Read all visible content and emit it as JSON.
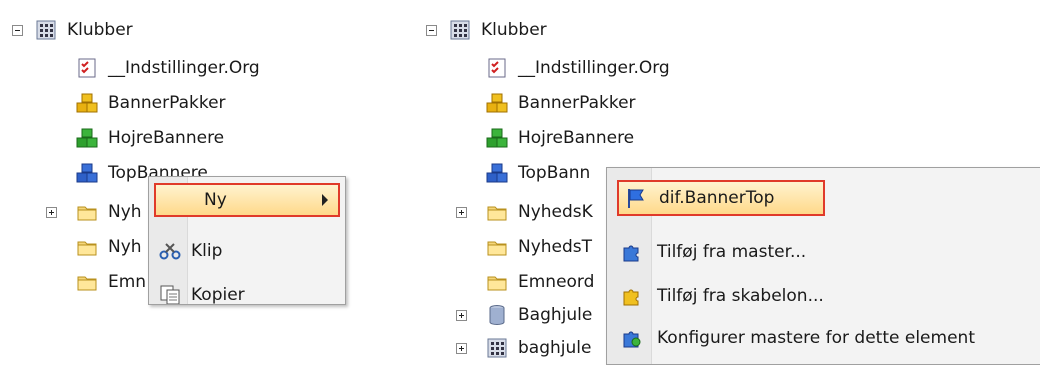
{
  "left": {
    "tree": {
      "root": "Klubber",
      "items": [
        "__Indstillinger.Org",
        "BannerPakker",
        "HojreBannere",
        "TopBannere",
        "Nyh",
        "Nyh",
        "Emn"
      ]
    },
    "menu": {
      "ny": "Ny",
      "klip": "Klip",
      "kopier": "Kopier"
    }
  },
  "right": {
    "tree": {
      "root": "Klubber",
      "items": [
        "__Indstillinger.Org",
        "BannerPakker",
        "HojreBannere",
        "TopBann",
        "NyhedsK",
        "NyhedsT",
        "Emneord",
        "Baghjule",
        "baghjule"
      ]
    },
    "submenu": {
      "items": [
        "dif.BannerTop",
        "Tilføj fra master...",
        "Tilføj fra skabelon...",
        "Konfigurer mastere for dette element"
      ]
    }
  },
  "colors": {
    "highlight_border": "#e03a2a",
    "highlight_fill": "#ffd98a",
    "menu_bg": "#f3f3f3"
  }
}
